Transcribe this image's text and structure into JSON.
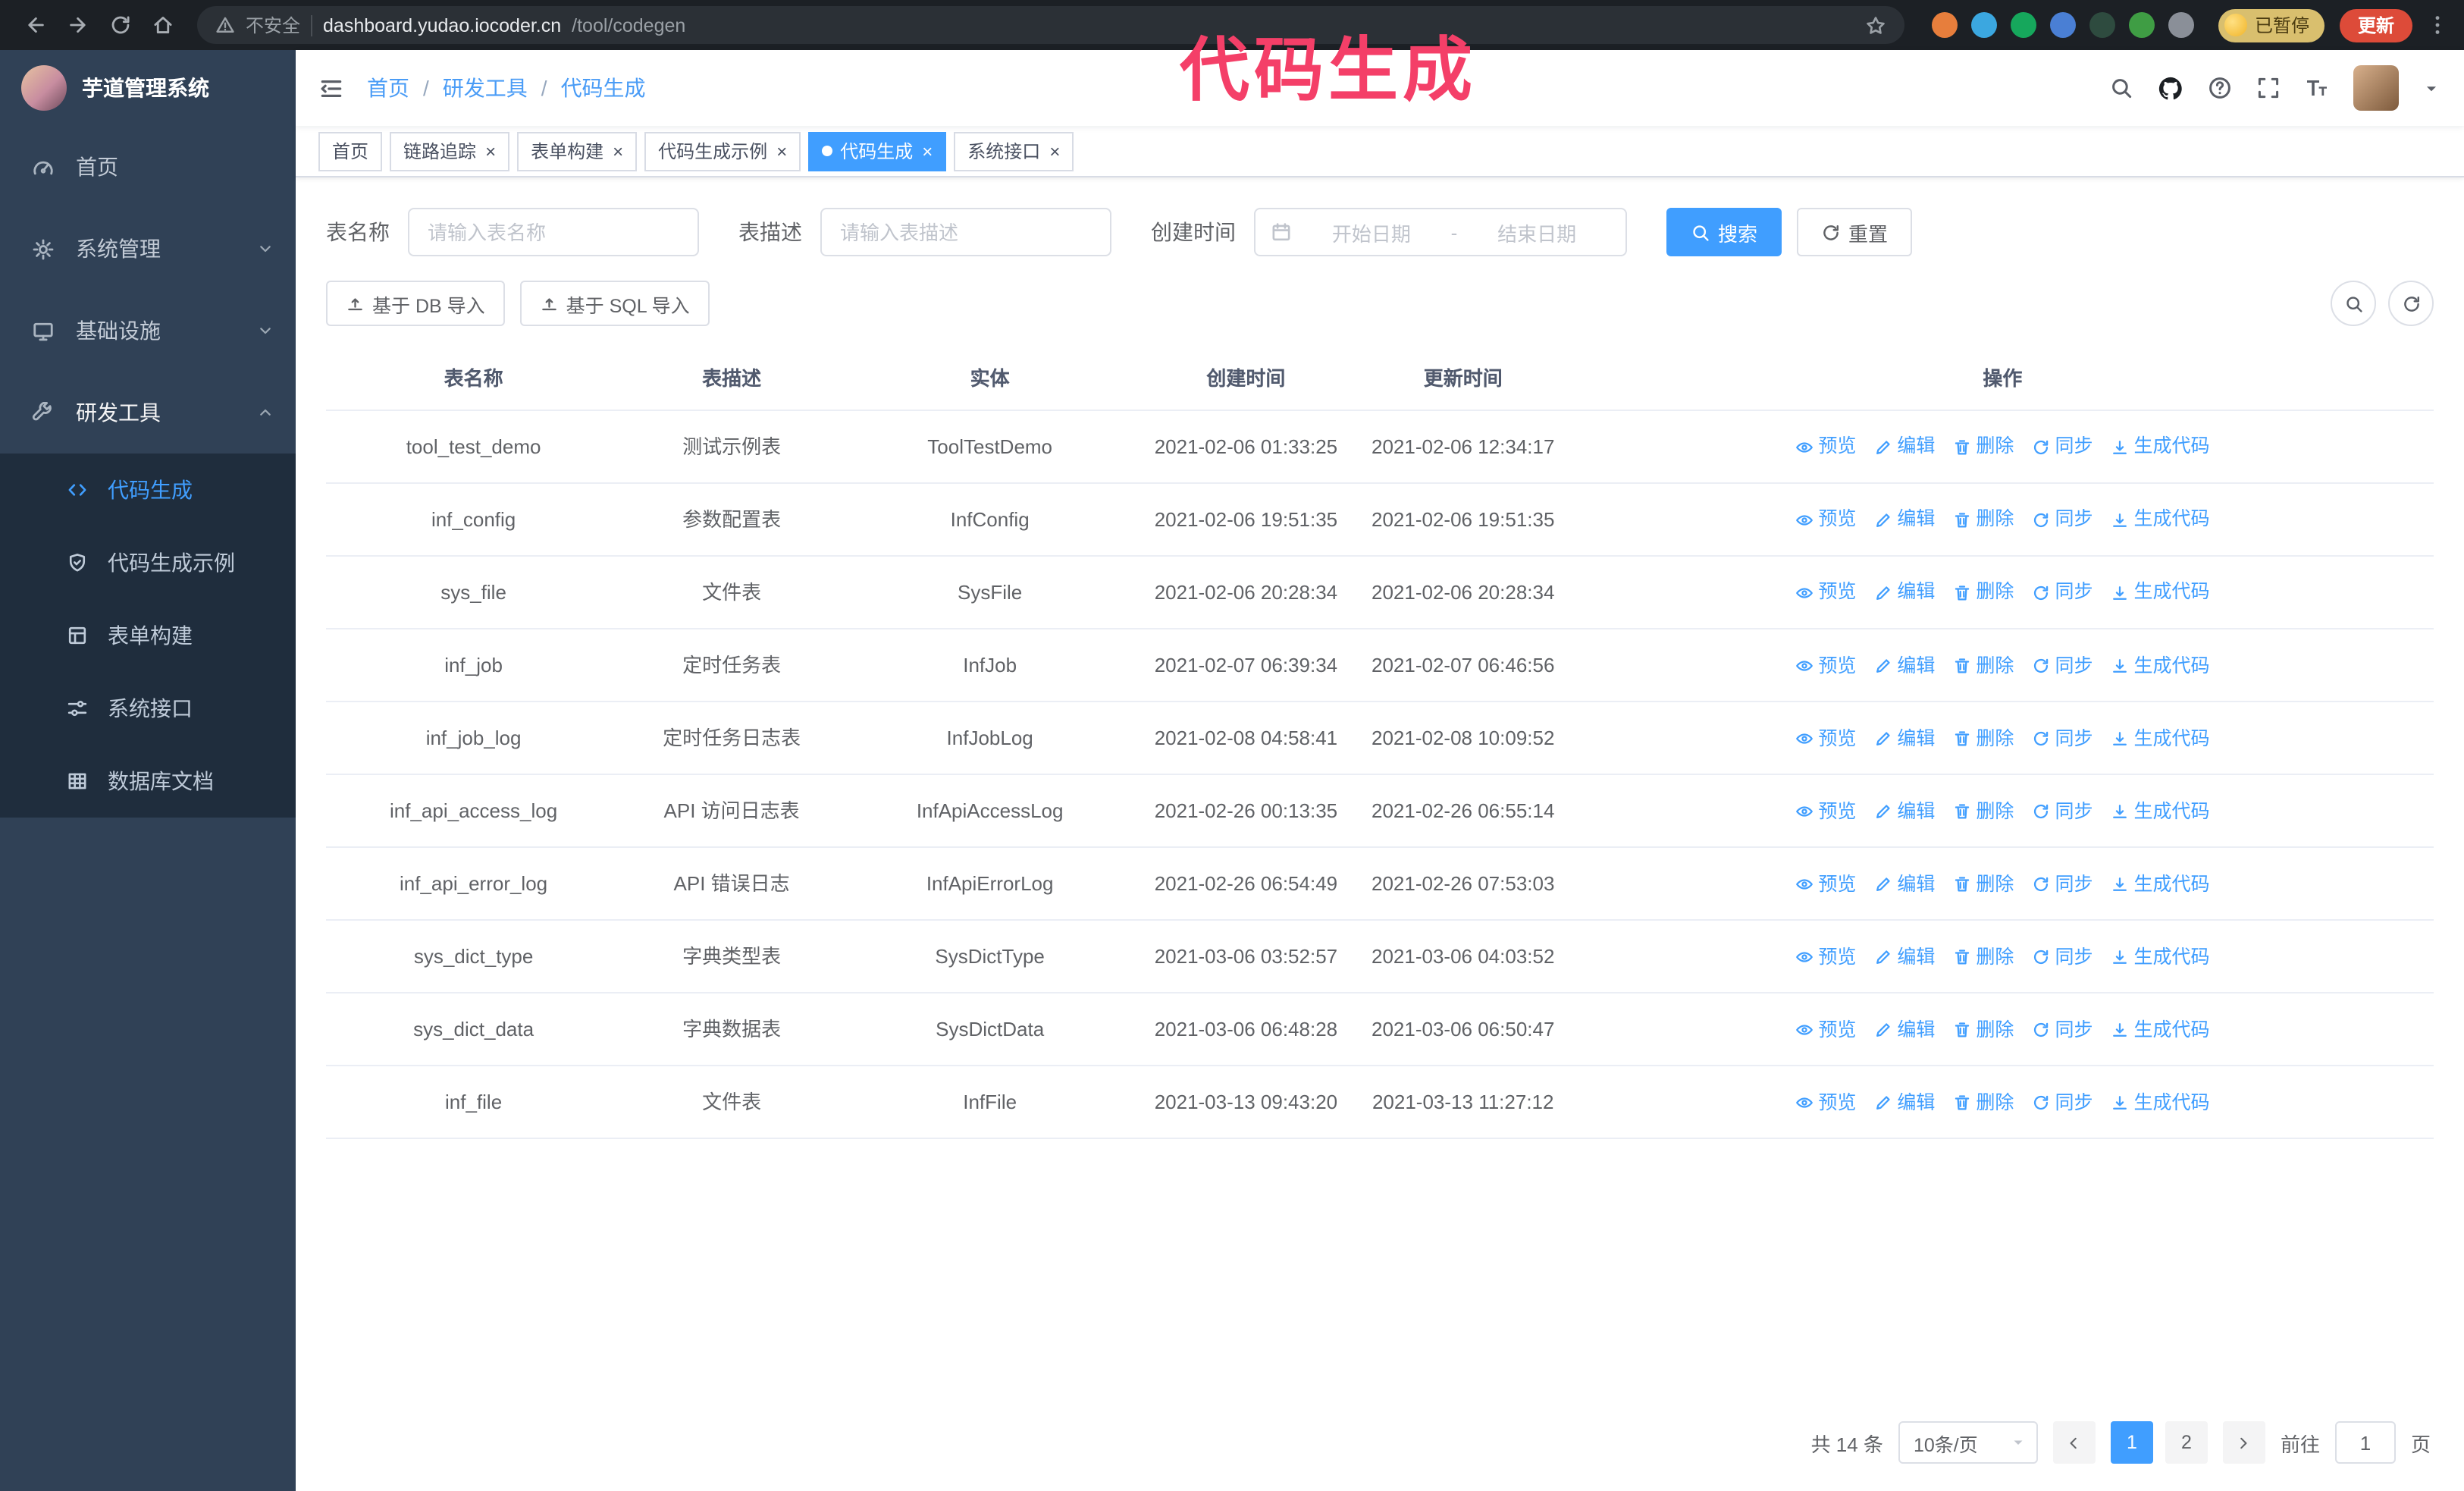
{
  "browser": {
    "insecure_label": "不安全",
    "host": "dashboard.yudao.iocoder.cn",
    "path": "/tool/codegen",
    "paused_chip": "已暂停",
    "update_button": "更新",
    "extensions": [
      {
        "name": "fox-extension-icon",
        "color": "#e77e3c"
      },
      {
        "name": "drop-extension-icon",
        "color": "#3ba7e0"
      },
      {
        "name": "check-extension-icon",
        "color": "#16a75c"
      },
      {
        "name": "users-extension-icon",
        "color": "#4a7fd4"
      },
      {
        "name": "chart-extension-icon",
        "color": "#2e4b3f"
      },
      {
        "name": "leaf-extension-icon",
        "color": "#3f9d44"
      },
      {
        "name": "puzzle-extension-icon",
        "color": "#8a8f98"
      }
    ]
  },
  "annotation": {
    "text": "代码生成",
    "color": "#f43f68"
  },
  "sidebar": {
    "logo_title": "芋道管理系统",
    "items": [
      {
        "label": "首页",
        "icon": "dashboard-icon"
      },
      {
        "label": "系统管理",
        "icon": "gear-icon",
        "chevron_icon": "chevron-down-icon"
      },
      {
        "label": "基础设施",
        "icon": "infra-icon",
        "chevron_icon": "chevron-down-icon"
      },
      {
        "label": "研发工具",
        "icon": "tool-icon",
        "chevron_icon": "chevron-up-icon",
        "active": true
      }
    ],
    "sub_items": [
      {
        "label": "代码生成",
        "icon": "code-icon",
        "active": true
      },
      {
        "label": "代码生成示例",
        "icon": "example-icon"
      },
      {
        "label": "表单构建",
        "icon": "form-icon"
      },
      {
        "label": "系统接口",
        "icon": "api-icon"
      },
      {
        "label": "数据库文档",
        "icon": "dbdoc-icon"
      }
    ]
  },
  "header": {
    "breadcrumb": [
      {
        "label": "首页"
      },
      {
        "label": "研发工具"
      },
      {
        "label": "代码生成"
      }
    ]
  },
  "tabs": [
    {
      "label": "首页",
      "closable": false
    },
    {
      "label": "链路追踪",
      "closable": true
    },
    {
      "label": "表单构建",
      "closable": true
    },
    {
      "label": "代码生成示例",
      "closable": true
    },
    {
      "label": "代码生成",
      "closable": true,
      "active": true
    },
    {
      "label": "系统接口",
      "closable": true
    }
  ],
  "filters": {
    "table_name_label": "表名称",
    "table_name_placeholder": "请输入表名称",
    "table_desc_label": "表描述",
    "table_desc_placeholder": "请输入表描述",
    "create_time_label": "创建时间",
    "start_date_placeholder": "开始日期",
    "range_separator": "-",
    "end_date_placeholder": "结束日期",
    "search_button": "搜索",
    "reset_button": "重置"
  },
  "toolbar": {
    "import_db_button": "基于 DB 导入",
    "import_sql_button": "基于 SQL 导入"
  },
  "table": {
    "columns": [
      "表名称",
      "表描述",
      "实体",
      "创建时间",
      "更新时间",
      "操作"
    ],
    "actions": [
      "预览",
      "编辑",
      "删除",
      "同步",
      "生成代码"
    ],
    "action_icons": [
      "eye-icon",
      "edit-icon",
      "trash-icon",
      "sync-icon",
      "download-icon"
    ],
    "rows": [
      {
        "name": "tool_test_demo",
        "desc": "测试示例表",
        "entity": "ToolTestDemo",
        "created": "2021-02-06 01:33:25",
        "updated": "2021-02-06 12:34:17"
      },
      {
        "name": "inf_config",
        "desc": "参数配置表",
        "entity": "InfConfig",
        "created": "2021-02-06 19:51:35",
        "updated": "2021-02-06 19:51:35"
      },
      {
        "name": "sys_file",
        "desc": "文件表",
        "entity": "SysFile",
        "created": "2021-02-06 20:28:34",
        "updated": "2021-02-06 20:28:34"
      },
      {
        "name": "inf_job",
        "desc": "定时任务表",
        "entity": "InfJob",
        "created": "2021-02-07 06:39:34",
        "updated": "2021-02-07 06:46:56"
      },
      {
        "name": "inf_job_log",
        "desc": "定时任务日志表",
        "entity": "InfJobLog",
        "created": "2021-02-08 04:58:41",
        "updated": "2021-02-08 10:09:52"
      },
      {
        "name": "inf_api_access_log",
        "desc": "API 访问日志表",
        "entity": "InfApiAccessLog",
        "created": "2021-02-26 00:13:35",
        "updated": "2021-02-26 06:55:14"
      },
      {
        "name": "inf_api_error_log",
        "desc": "API 错误日志",
        "entity": "InfApiErrorLog",
        "created": "2021-02-26 06:54:49",
        "updated": "2021-02-26 07:53:03"
      },
      {
        "name": "sys_dict_type",
        "desc": "字典类型表",
        "entity": "SysDictType",
        "created": "2021-03-06 03:52:57",
        "updated": "2021-03-06 04:03:52"
      },
      {
        "name": "sys_dict_data",
        "desc": "字典数据表",
        "entity": "SysDictData",
        "created": "2021-03-06 06:48:28",
        "updated": "2021-03-06 06:50:47"
      },
      {
        "name": "inf_file",
        "desc": "文件表",
        "entity": "InfFile",
        "created": "2021-03-13 09:43:20",
        "updated": "2021-03-13 11:27:12"
      }
    ]
  },
  "pagination": {
    "total_text": "共 14 条",
    "page_size_text": "10条/页",
    "pages": [
      {
        "label": "1",
        "active": true
      },
      {
        "label": "2"
      }
    ],
    "goto_label": "前往",
    "goto_value": "1",
    "goto_suffix": "页"
  }
}
